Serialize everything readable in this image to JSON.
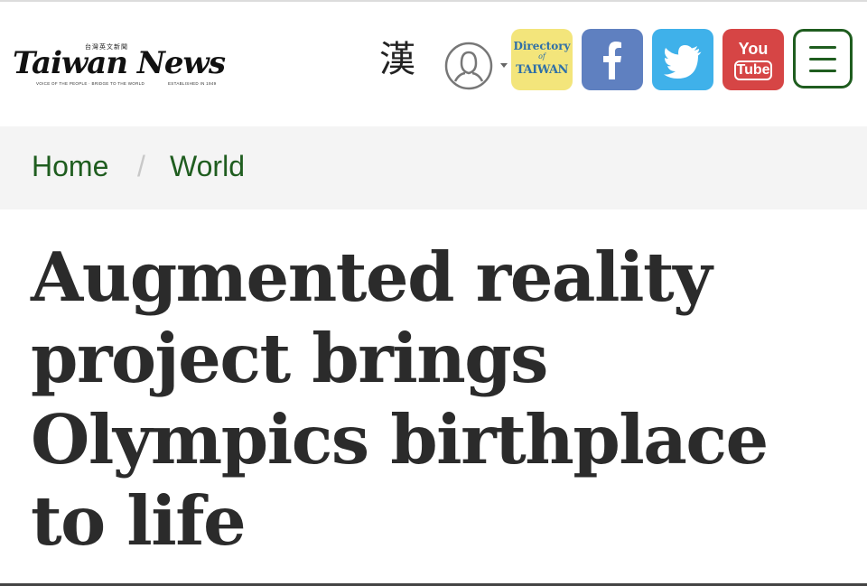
{
  "header": {
    "logo": {
      "name": "Taiwan News",
      "chinese": "台灣英文新聞",
      "tagline_left": "VOICE OF THE PEOPLE · BRIDGE TO THE WORLD",
      "tagline_right": "ESTABLISHED IN 1949"
    },
    "language_toggle": "漢",
    "user_icon": "user-icon",
    "directory": {
      "line1": "Directory",
      "line2": "of",
      "line3": "TAIWAN"
    },
    "facebook_icon": "facebook-icon",
    "twitter_icon": "twitter-icon",
    "youtube": {
      "line1": "You",
      "line2": "Tube"
    },
    "menu_icon": "hamburger-menu-icon"
  },
  "breadcrumb": {
    "home": "Home",
    "separator": "/",
    "current": "World"
  },
  "article": {
    "headline": "Augmented reality project brings Olympics birthplace to life"
  },
  "colors": {
    "brand_green": "#1f5d1f",
    "facebook": "#5f80c0",
    "twitter": "#3fb1ea",
    "youtube": "#d64545",
    "directory": "#f3e57b"
  }
}
